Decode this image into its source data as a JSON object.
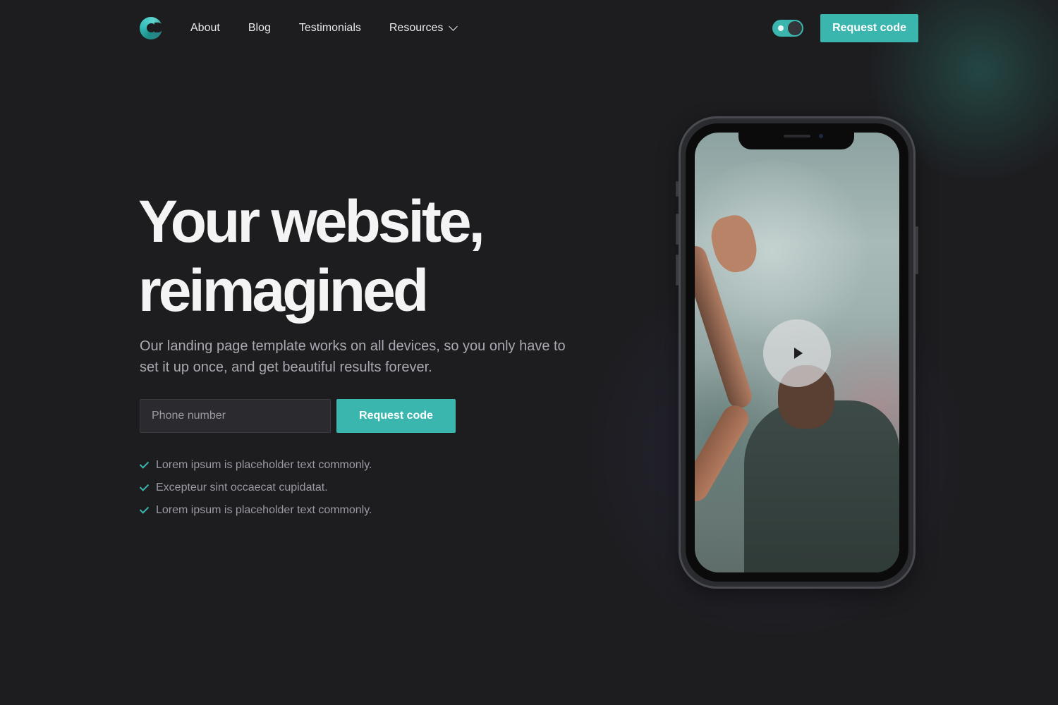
{
  "header": {
    "logo": "app-logo",
    "nav": [
      {
        "label": "About"
      },
      {
        "label": "Blog"
      },
      {
        "label": "Testimonials"
      },
      {
        "label": "Resources"
      }
    ],
    "cta_label": "Request code"
  },
  "hero": {
    "title_line1": "Your website,",
    "title_line2": "reimagined",
    "subtitle": "Our landing page template works on all devices, so you only have to set it up once, and get beautiful results forever.",
    "phone_placeholder": "Phone number",
    "phone_value": "",
    "submit_label": "Request code",
    "checks": [
      "Lorem ipsum is placeholder text commonly.",
      "Excepteur sint occaecat cupidatat.",
      "Lorem ipsum is placeholder text commonly."
    ]
  },
  "colors": {
    "accent": "#3ab6ae",
    "background": "#1d1d20",
    "text": "#f4f4f5",
    "muted": "#a9a9b1"
  },
  "icons": {
    "dropdown": "chevron-down-icon",
    "check": "check-icon",
    "play": "play-icon",
    "theme_toggle": "dark-mode-toggle"
  },
  "toggle": {
    "dark_mode": true
  }
}
